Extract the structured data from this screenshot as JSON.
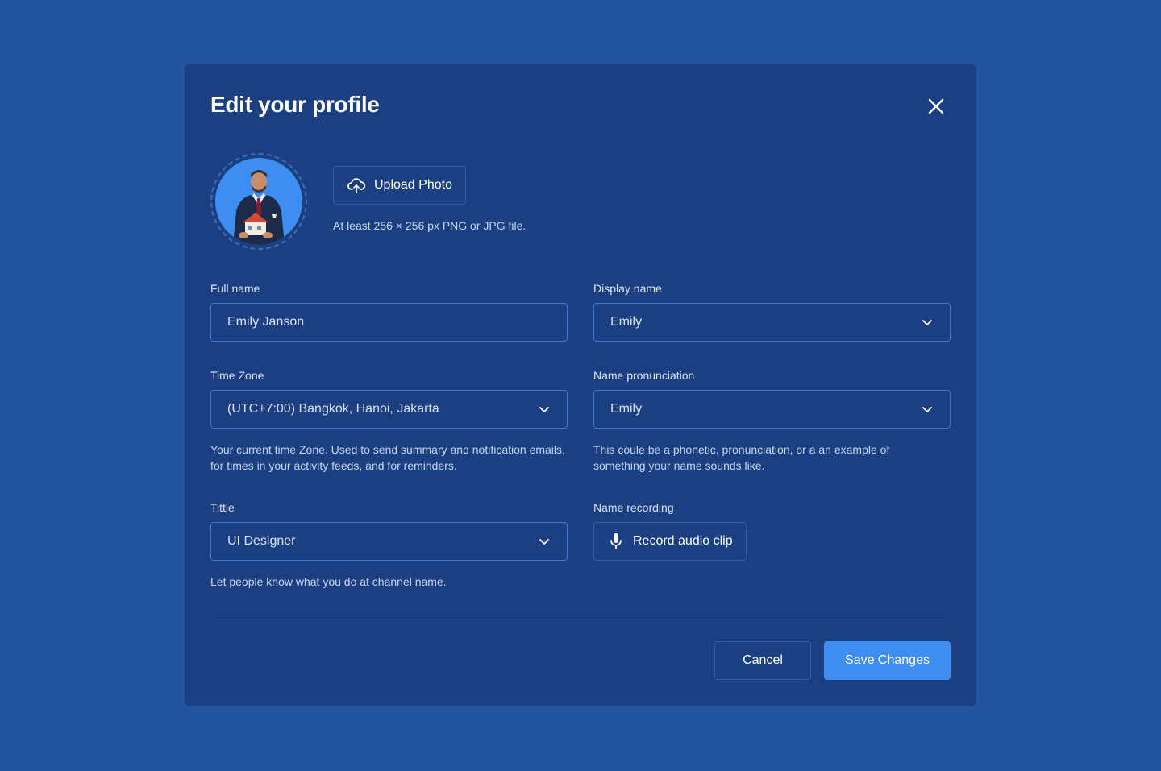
{
  "modal": {
    "title": "Edit your profile"
  },
  "photo": {
    "upload_label": "Upload Photo",
    "hint": "At least 256 × 256 px PNG or JPG file."
  },
  "fields": {
    "full_name": {
      "label": "Full name",
      "value": "Emily Janson"
    },
    "display_name": {
      "label": "Display name",
      "value": "Emily"
    },
    "time_zone": {
      "label": "Time Zone",
      "value": "(UTC+7:00) Bangkok, Hanoi, Jakarta",
      "help": "Your current time Zone. Used to send summary and notification emails, for times in your activity feeds, and for reminders."
    },
    "name_pronunciation": {
      "label": "Name pronunciation",
      "value": "Emily",
      "help": "This coule be a phonetic, pronunciation, or a an example of something your name sounds like."
    },
    "title": {
      "label": "Tittle",
      "value": "UI Designer",
      "help": "Let people know what you do at channel name."
    },
    "name_recording": {
      "label": "Name recording",
      "button_label": "Record audio clip"
    }
  },
  "footer": {
    "cancel_label": "Cancel",
    "save_label": "Save Changes"
  },
  "colors": {
    "background": "#2254a0",
    "modal": "#1b3f80",
    "accent": "#3d8ef0",
    "input_border": "#3b7ad6"
  },
  "icons": {
    "close": "close-icon",
    "upload": "cloud-upload-icon",
    "chevron": "chevron-down-icon",
    "mic": "microphone-icon"
  }
}
